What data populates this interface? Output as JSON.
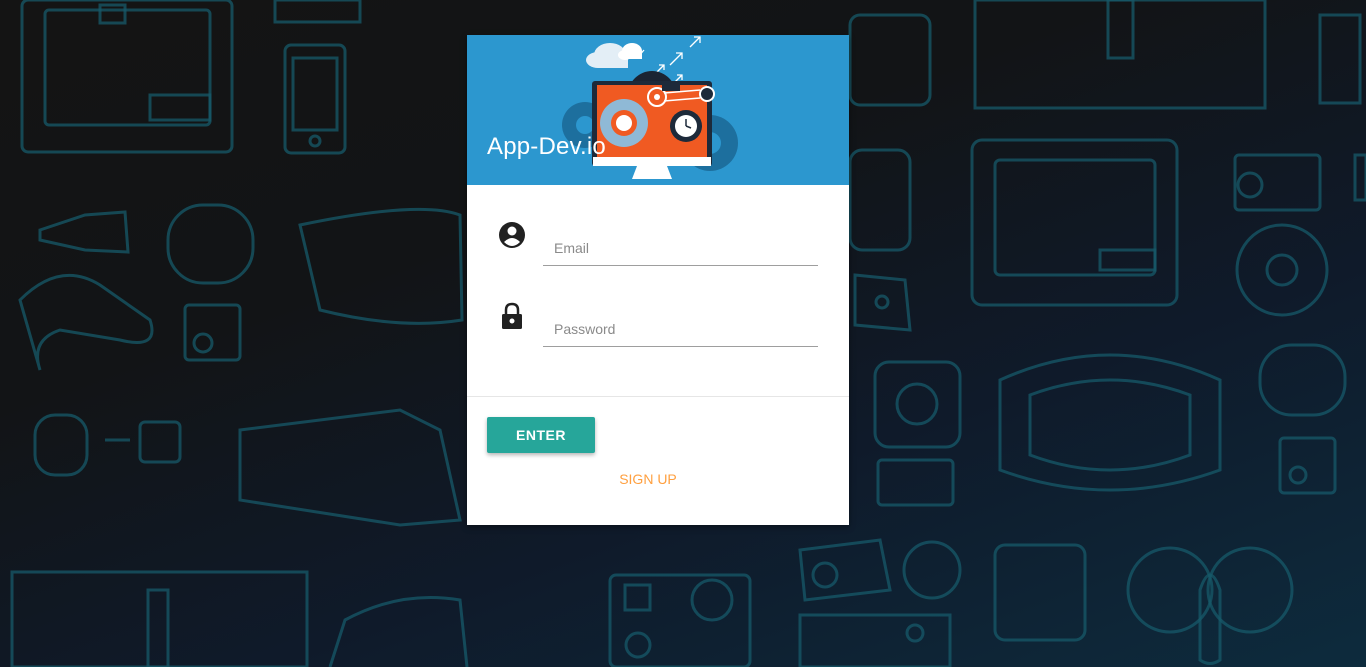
{
  "app": {
    "title": "App-Dev.io"
  },
  "form": {
    "email": {
      "value": "",
      "placeholder": "Email",
      "icon": "account-circle-icon"
    },
    "password": {
      "value": "",
      "placeholder": "Password",
      "icon": "lock-icon"
    },
    "enter_label": "ENTER",
    "signup_label": "SIGN UP"
  },
  "colors": {
    "header": "#2c97cf",
    "enter_button": "#26a69a",
    "signup_link": "#ffa040",
    "background_line": "#17596a"
  }
}
